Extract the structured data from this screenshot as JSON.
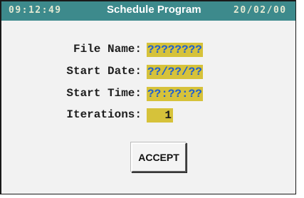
{
  "header": {
    "time": "09:12:49",
    "title": "Schedule Program",
    "date": "20/02/00"
  },
  "form": {
    "file_name": {
      "label": "File Name:",
      "value": "????????"
    },
    "start_date": {
      "label": "Start Date:",
      "value": "??/??/??"
    },
    "start_time": {
      "label": "Start Time:",
      "value": "??:??:??"
    },
    "iterations": {
      "label": "Iterations:",
      "value": "1"
    }
  },
  "actions": {
    "accept_label": "ACCEPT"
  },
  "colors": {
    "header_bg": "#3d8a8c",
    "field_bg": "#d6c23a",
    "field_text": "#1e5fd0",
    "panel_bg": "#f2f2f2"
  }
}
